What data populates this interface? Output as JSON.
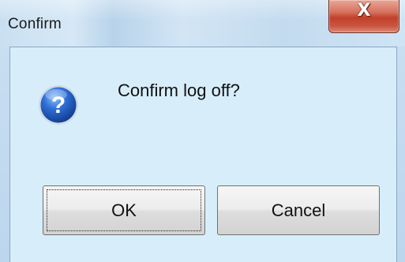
{
  "window": {
    "title": "Confirm",
    "close_label": "X"
  },
  "dialog": {
    "icon": "question-icon",
    "message": "Confirm log off?"
  },
  "buttons": {
    "ok_label": "OK",
    "cancel_label": "Cancel"
  },
  "colors": {
    "content_background": "#d7eefa",
    "titlebar": "#c9e0f2",
    "close_button": "#c2402a",
    "icon_blue": "#1f57b8"
  }
}
